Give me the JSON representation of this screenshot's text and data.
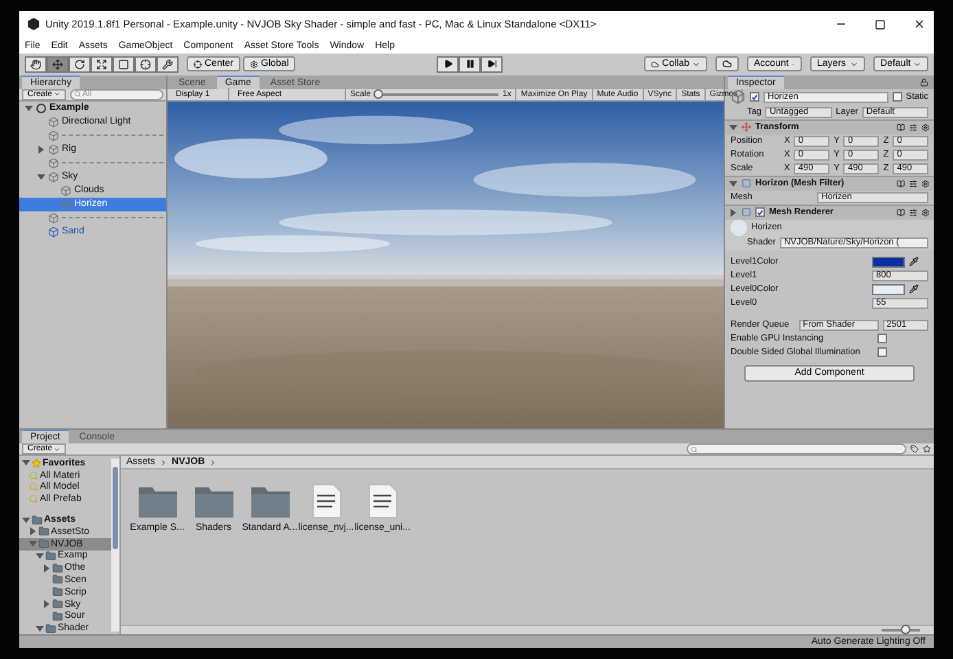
{
  "window": {
    "title": "Unity 2019.1.8f1 Personal - Example.unity - NVJOB Sky Shader - simple and fast - PC, Mac & Linux Standalone <DX11>"
  },
  "menu": [
    "File",
    "Edit",
    "Assets",
    "GameObject",
    "Component",
    "Asset Store Tools",
    "Window",
    "Help"
  ],
  "toolbar": {
    "tools": [
      {
        "kind": "hand",
        "selected": false
      },
      {
        "kind": "move",
        "selected": true
      },
      {
        "kind": "rotate",
        "selected": false
      },
      {
        "kind": "scale",
        "selected": false
      },
      {
        "kind": "rect",
        "selected": false
      },
      {
        "kind": "transform",
        "selected": false
      },
      {
        "kind": "custom",
        "selected": false
      }
    ],
    "pivot": [
      "Center",
      "Global"
    ],
    "collab": "Collab",
    "account": "Account",
    "layers": "Layers",
    "layout": "Default"
  },
  "hierarchy": {
    "tab": "Hierarchy",
    "create": "Create",
    "search_placeholder": "All",
    "scene": "Example",
    "items": [
      {
        "kind": "object",
        "name": "Directional Light",
        "selected": false
      },
      {
        "kind": "separator"
      },
      {
        "kind": "object",
        "name": "Rig",
        "selected": false,
        "expanded": false
      },
      {
        "kind": "separator"
      },
      {
        "kind": "object",
        "name": "Sky",
        "selected": false,
        "expanded": true,
        "children": [
          {
            "kind": "object",
            "name": "Clouds",
            "selected": false
          },
          {
            "kind": "object",
            "name": "Horizen",
            "selected": true
          }
        ]
      },
      {
        "kind": "separator"
      },
      {
        "kind": "prefab",
        "name": "Sand",
        "selected": false
      }
    ]
  },
  "game": {
    "tabs": [
      {
        "label": "Scene",
        "selected": false
      },
      {
        "label": "Game",
        "selected": true
      },
      {
        "label": "Asset Store",
        "selected": false
      }
    ],
    "display": "Display 1",
    "aspect": "Free Aspect",
    "scale_label": "Scale",
    "scale": {
      "level": 0.02
    },
    "scale_reading": "1x",
    "toggles": [
      "Maximize On Play",
      "Mute Audio",
      "VSync",
      "Stats",
      "Gizmos"
    ]
  },
  "inspector": {
    "tab": "Inspector",
    "name": "Horizen",
    "active": true,
    "static_label": "Static",
    "static": false,
    "tag_label": "Tag",
    "tag": "Untagged",
    "layer_label": "Layer",
    "layer": "Default",
    "transform": {
      "title": "Transform",
      "rows": [
        {
          "label": "Position",
          "values": [
            {
              "axis": "X",
              "value": "0"
            },
            {
              "axis": "Y",
              "value": "0"
            },
            {
              "axis": "Z",
              "value": "0"
            }
          ]
        },
        {
          "label": "Rotation",
          "values": [
            {
              "axis": "X",
              "value": "0"
            },
            {
              "axis": "Y",
              "value": "0"
            },
            {
              "axis": "Z",
              "value": "0"
            }
          ]
        },
        {
          "label": "Scale",
          "values": [
            {
              "axis": "X",
              "value": "490"
            },
            {
              "axis": "Y",
              "value": "490"
            },
            {
              "axis": "Z",
              "value": "490"
            }
          ]
        }
      ]
    },
    "mesh_filter": {
      "title": "Horizon (Mesh Filter)",
      "label": "Mesh",
      "value": "Horizen"
    },
    "mesh_renderer": {
      "title": "Mesh Renderer",
      "enabled": true,
      "expanded": false
    },
    "material": {
      "name": "Horizen",
      "shader_label": "Shader",
      "shader": "NVJOB/Nature/Sky/Horizon (",
      "properties": [
        {
          "kind": "color",
          "label": "Level1Color",
          "color": "#0a2ea6"
        },
        {
          "kind": "number",
          "label": "Level1",
          "value": "800"
        },
        {
          "kind": "color",
          "label": "Level0Color",
          "color": "#e6eefa"
        },
        {
          "kind": "number",
          "label": "Level0",
          "value": "55"
        }
      ],
      "render_queue_label": "Render Queue",
      "render_queue_mode": "From Shader",
      "render_queue": "2501",
      "options": [
        {
          "label": "Enable GPU Instancing",
          "checked": false
        },
        {
          "label": "Double Sided Global Illumination",
          "checked": false
        }
      ]
    },
    "add_component": "Add Component"
  },
  "project": {
    "tabs": [
      {
        "label": "Project",
        "selected": true
      },
      {
        "label": "Console",
        "selected": false
      }
    ],
    "create": "Create",
    "favorites": {
      "label": "Favorites",
      "items": [
        "All Materi",
        "All Model",
        "All Prefab"
      ]
    },
    "tree": [
      {
        "name": "Assets",
        "expanded": true,
        "selected": false,
        "children": [
          {
            "name": "AssetSto",
            "expanded": false,
            "selected": false
          },
          {
            "name": "NVJOB",
            "expanded": true,
            "selected": true,
            "children": [
              {
                "name": "Examp",
                "expanded": true,
                "selected": false,
                "children": [
                  {
                    "name": "Othe",
                    "expanded": false,
                    "selected": false
                  },
                  {
                    "name": "Scen",
                    "selected": false
                  },
                  {
                    "name": "Scrip",
                    "selected": false
                  },
                  {
                    "name": "Sky",
                    "expanded": false,
                    "selected": false
                  },
                  {
                    "name": "Sour",
                    "selected": false
                  }
                ]
              },
              {
                "name": "Shader",
                "expanded": true,
                "selected": false
              }
            ]
          }
        ]
      }
    ],
    "breadcrumb": [
      "Assets",
      "NVJOB"
    ],
    "assets": [
      {
        "kind": "folder",
        "name": "Example S..."
      },
      {
        "kind": "folder",
        "name": "Shaders"
      },
      {
        "kind": "folder",
        "name": "Standard A..."
      },
      {
        "kind": "document",
        "name": "license_nvj..."
      },
      {
        "kind": "document",
        "name": "license_uni..."
      }
    ],
    "zoom": {
      "level": 0.6
    }
  },
  "status_bar": "Auto Generate Lighting Off"
}
